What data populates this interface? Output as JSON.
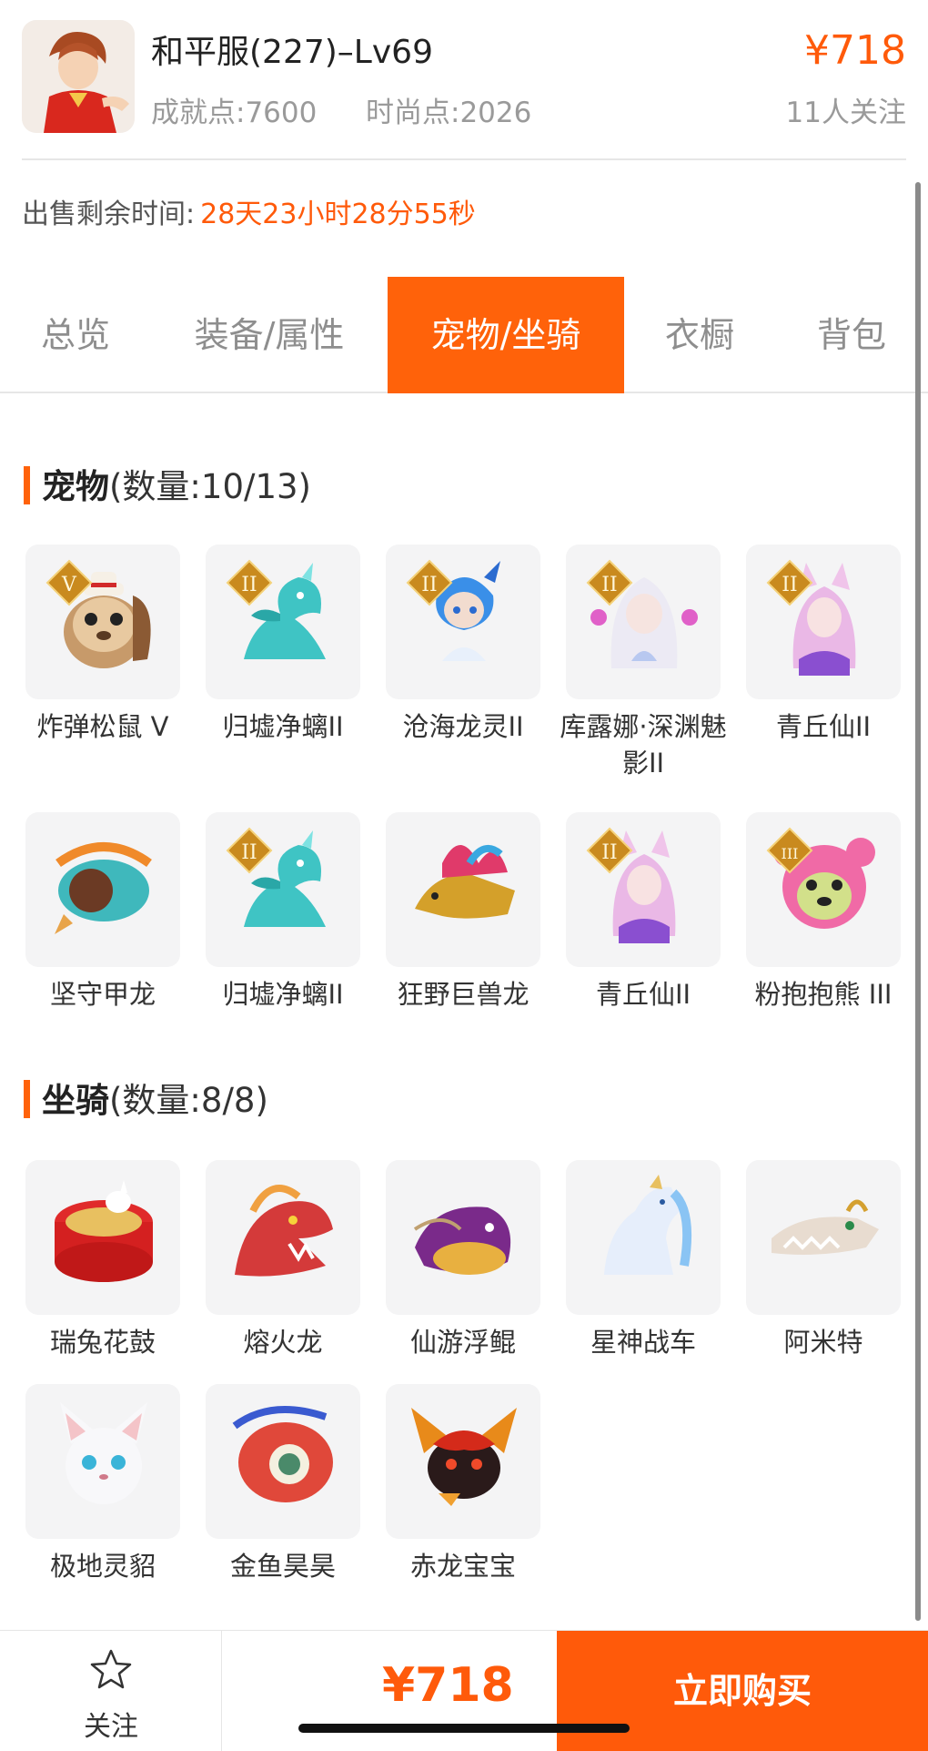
{
  "header": {
    "title": "和平服(227)–Lv69",
    "achievement": "成就点:7600",
    "fashion": "时尚点:2026",
    "price": "¥718",
    "followers": "11人关注"
  },
  "remaining": {
    "label": "出售剩余时间:",
    "value": "28天23小时28分55秒"
  },
  "tabs": [
    "总览",
    "装备/属性",
    "宠物/坐骑",
    "衣橱",
    "背包"
  ],
  "active_tab": "宠物/坐骑",
  "pets": {
    "title": "宠物",
    "count": "(数量:10/13)",
    "items": [
      {
        "name": "炸弹松鼠 V",
        "badge": "V",
        "icon": "squirrel-icon"
      },
      {
        "name": "归墟净螭II",
        "badge": "II",
        "icon": "dragon-icon"
      },
      {
        "name": "沧海龙灵II",
        "badge": "II",
        "icon": "dragon-spirit-icon"
      },
      {
        "name": "库露娜·深渊魅影II",
        "badge": "II",
        "icon": "fairy-icon"
      },
      {
        "name": "青丘仙II",
        "badge": "II",
        "icon": "fox-fairy-icon"
      },
      {
        "name": "坚守甲龙",
        "badge": "",
        "icon": "armored-dragon-icon"
      },
      {
        "name": "归墟净螭II",
        "badge": "II",
        "icon": "dragon-icon"
      },
      {
        "name": "狂野巨兽龙",
        "badge": "",
        "icon": "beast-dragon-icon"
      },
      {
        "name": "青丘仙II",
        "badge": "II",
        "icon": "fox-fairy-icon"
      },
      {
        "name": "粉抱抱熊 III",
        "badge": "III",
        "icon": "bear-icon"
      }
    ]
  },
  "mounts": {
    "title": "坐骑",
    "count": "(数量:8/8)",
    "items": [
      {
        "name": "瑞兔花鼓",
        "icon": "drum-icon"
      },
      {
        "name": "熔火龙",
        "icon": "fire-dragon-icon"
      },
      {
        "name": "仙游浮鲲",
        "icon": "whale-icon"
      },
      {
        "name": "星神战车",
        "icon": "horse-icon"
      },
      {
        "name": "阿米特",
        "icon": "crocodile-icon"
      },
      {
        "name": "极地灵貂",
        "icon": "fox-icon"
      },
      {
        "name": "金鱼昊昊",
        "icon": "goldfish-icon"
      },
      {
        "name": "赤龙宝宝",
        "icon": "baby-dragon-icon"
      }
    ]
  },
  "bottom": {
    "follow": "关注",
    "price": "¥718",
    "buy": "立即购买"
  },
  "colors": {
    "accent": "#ff620a",
    "text": "#333333",
    "muted": "#9a9a9a"
  }
}
